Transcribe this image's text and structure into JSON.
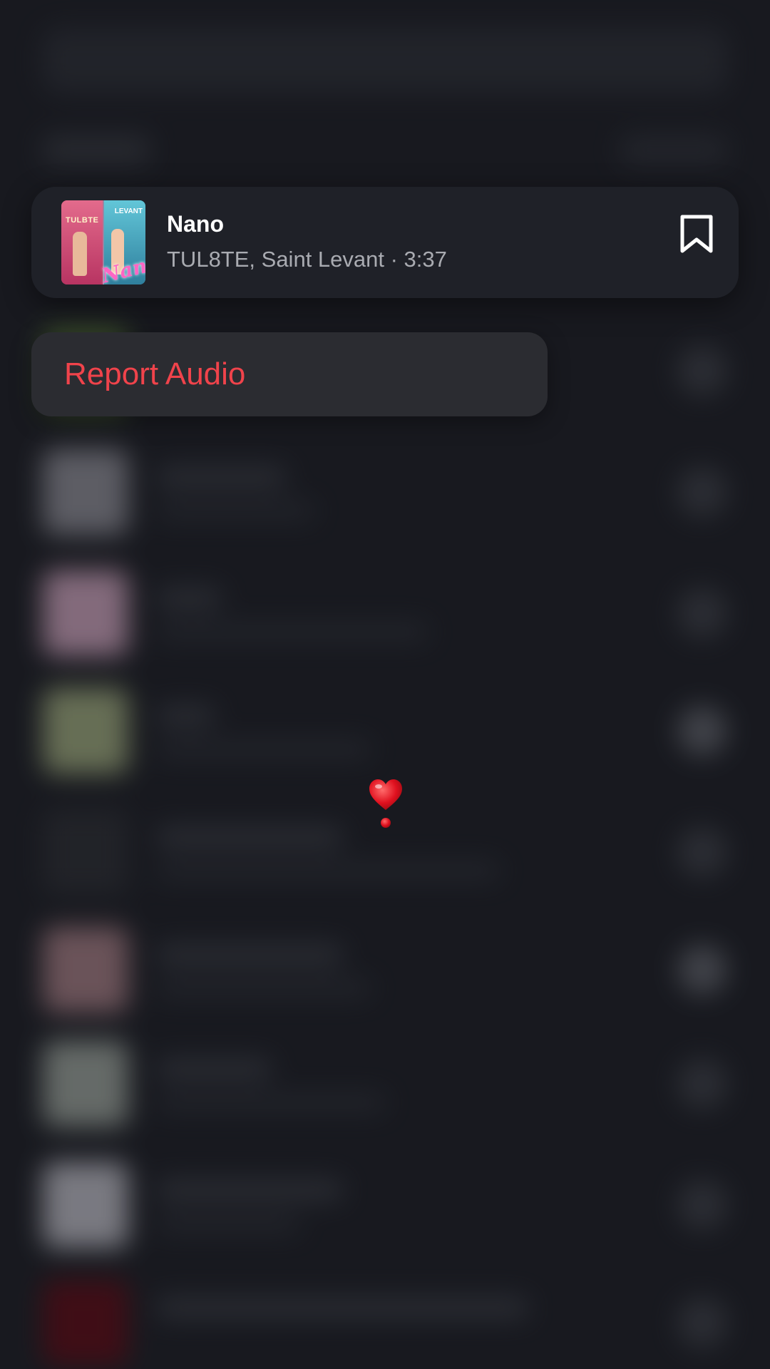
{
  "track": {
    "title": "Nano",
    "subtitle": "TUL8TE, Saint Levant · 3:37",
    "cover_label_left": "TULBTE",
    "cover_label_right": "LEVANT",
    "cover_script": "Nano"
  },
  "menu": {
    "items": [
      {
        "label": "Report Audio"
      }
    ]
  },
  "colors": {
    "background": "#1b1d23",
    "card": "#1f2128",
    "menu": "#2b2c31",
    "danger": "#f0434b",
    "title": "#ffffff",
    "subtitle": "#a9abb1"
  },
  "icons": {
    "bookmark": "bookmark-outline-icon",
    "heart": "heart-exclamation-icon"
  }
}
